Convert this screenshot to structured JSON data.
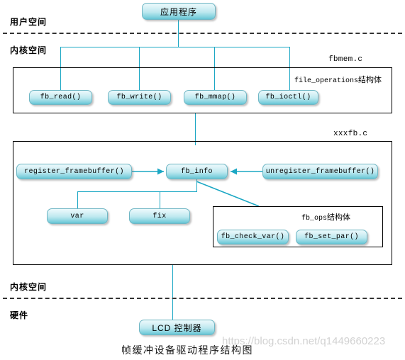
{
  "diagram": {
    "caption": "帧缓冲设备驱动程序结构图",
    "watermark": "https://blog.csdn.net/q1449660223",
    "accent_color": "#1ba7c4",
    "node_fill_top": "#eaf9fb",
    "node_fill_bottom": "#63c3d3",
    "border_color": "#000000"
  },
  "zones": {
    "user_space": "用户空间",
    "kernel_space_top": "内核空间",
    "kernel_space_bottom": "内核空间",
    "hardware": "硬件"
  },
  "nodes": {
    "app": "应用程序",
    "lcd_controller": "LCD 控制器",
    "fb_info": "fb_info",
    "register_framebuffer": "register_framebuffer()",
    "unregister_framebuffer": "unregister_framebuffer()",
    "var": "var",
    "fix": "fix"
  },
  "fbmem": {
    "file_label": "fbmem.c",
    "struct_label_code": "file_operations",
    "struct_label_cjk": "结构体",
    "ops": [
      {
        "label": "fb_read()"
      },
      {
        "label": "fb_write()"
      },
      {
        "label": "fb_mmap()"
      },
      {
        "label": "fb_ioctl()"
      }
    ]
  },
  "xxxfb": {
    "file_label": "xxxfb.c",
    "fb_ops_label_code": "fb_ops",
    "fb_ops_label_cjk": "结构体",
    "fb_ops_functions": [
      {
        "label": "fb_check_var()"
      },
      {
        "label": "fb_set_par()"
      }
    ]
  }
}
